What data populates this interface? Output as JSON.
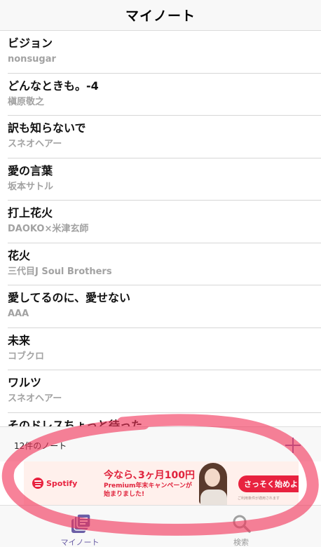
{
  "header": {
    "title": "マイノート"
  },
  "songs": [
    {
      "title": "ビジョン",
      "artist": "nonsugar"
    },
    {
      "title": "どんなときも。-4",
      "artist": "槇原敬之"
    },
    {
      "title": "訳も知らないで",
      "artist": "スネオヘアー"
    },
    {
      "title": "愛の言葉",
      "artist": "坂本サトル"
    },
    {
      "title": "打上花火",
      "artist": "DAOKO×米津玄師"
    },
    {
      "title": "花火",
      "artist": "三代目J Soul Brothers"
    },
    {
      "title": "愛してるのに、愛せない",
      "artist": "AAA"
    },
    {
      "title": "未来",
      "artist": "コブクロ"
    },
    {
      "title": "ワルツ",
      "artist": "スネオヘアー"
    },
    {
      "title": "そのドレスちょっと待った",
      "artist": ""
    }
  ],
  "footer": {
    "note_count": "12件のノート"
  },
  "ad": {
    "brand": "Spotify",
    "headline": "今なら､3ヶ月100円",
    "subline_1": "Premium年末キャンペーンが",
    "subline_2": "始まりました!",
    "cta": "さっそく始めよう",
    "fine_print": "ご利用条件が適用されます"
  },
  "tabs": [
    {
      "label": "マイノート",
      "icon": "notes-icon",
      "active": true
    },
    {
      "label": "検索",
      "icon": "search-icon",
      "active": false
    }
  ],
  "colors": {
    "accent": "#6b5ea6",
    "ad_red": "#e8223f",
    "highlight": "#f2365a"
  }
}
